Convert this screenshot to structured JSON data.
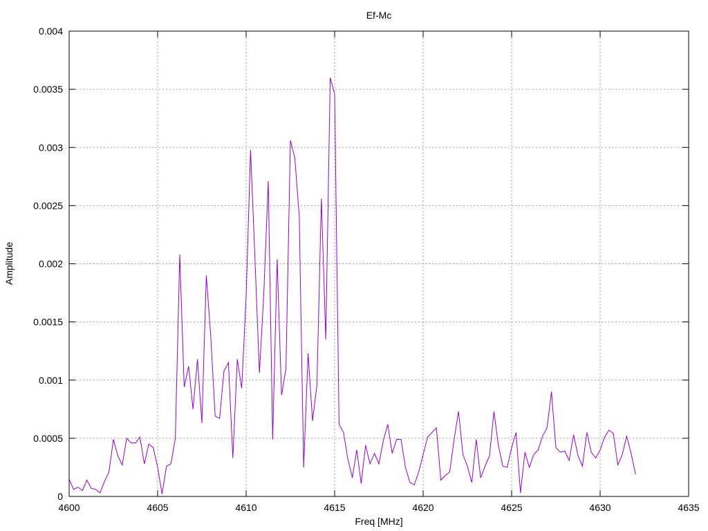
{
  "chart_data": {
    "type": "line",
    "title": "Ef-Mc",
    "xlabel": "Freq [MHz]",
    "ylabel": "Amplitude",
    "xlim": [
      4600,
      4635
    ],
    "ylim": [
      0,
      0.004
    ],
    "xticks": [
      4600,
      4605,
      4610,
      4615,
      4620,
      4625,
      4630,
      4635
    ],
    "yticks": [
      0,
      0.0005,
      0.001,
      0.0015,
      0.002,
      0.0025,
      0.003,
      0.0035,
      0.004
    ],
    "xtick_labels": [
      "4600",
      "4605",
      "4610",
      "4615",
      "4620",
      "4625",
      "4630",
      "4635"
    ],
    "ytick_labels": [
      "0",
      "0.0005",
      "0.001",
      "0.0015",
      "0.002",
      "0.0025",
      "0.003",
      "0.0035",
      "0.004"
    ],
    "grid": true,
    "series": [
      {
        "color": "#9400d3",
        "x": [
          4600.0,
          4600.25,
          4600.5,
          4600.75,
          4601.0,
          4601.25,
          4601.5,
          4601.75,
          4602.0,
          4602.25,
          4602.5,
          4602.75,
          4603.0,
          4603.25,
          4603.5,
          4603.75,
          4604.0,
          4604.25,
          4604.5,
          4604.75,
          4605.0,
          4605.25,
          4605.5,
          4605.75,
          4606.0,
          4606.25,
          4606.5,
          4606.75,
          4607.0,
          4607.25,
          4607.5,
          4607.75,
          4608.0,
          4608.25,
          4608.5,
          4608.75,
          4609.0,
          4609.25,
          4609.5,
          4609.75,
          4610.0,
          4610.25,
          4610.5,
          4610.75,
          4611.0,
          4611.25,
          4611.5,
          4611.75,
          4612.0,
          4612.25,
          4612.5,
          4612.75,
          4613.0,
          4613.25,
          4613.5,
          4613.75,
          4614.0,
          4614.25,
          4614.5,
          4614.75,
          4615.0,
          4615.25,
          4615.5,
          4615.75,
          4616.0,
          4616.25,
          4616.5,
          4616.75,
          4617.0,
          4617.25,
          4617.5,
          4617.75,
          4618.0,
          4618.25,
          4618.5,
          4618.75,
          4619.0,
          4619.25,
          4619.5,
          4619.75,
          4620.0,
          4620.25,
          4620.5,
          4620.75,
          4621.0,
          4621.25,
          4621.5,
          4621.75,
          4622.0,
          4622.25,
          4622.5,
          4622.75,
          4623.0,
          4623.25,
          4623.5,
          4623.75,
          4624.0,
          4624.25,
          4624.5,
          4624.75,
          4625.0,
          4625.25,
          4625.5,
          4625.75,
          4626.0,
          4626.25,
          4626.5,
          4626.75,
          4627.0,
          4627.25,
          4627.5,
          4627.75,
          4628.0,
          4628.25,
          4628.5,
          4628.75,
          4629.0,
          4629.25,
          4629.5,
          4629.75,
          4630.0,
          4630.25,
          4630.5,
          4630.75,
          4631.0,
          4631.25,
          4631.5,
          4631.75,
          4632.0
        ],
        "y": [
          0.00015,
          6e-05,
          8e-05,
          5e-05,
          0.00014,
          7e-05,
          6e-05,
          3e-05,
          0.00013,
          0.00021,
          0.00049,
          0.00035,
          0.00027,
          0.0005,
          0.00046,
          0.00046,
          0.00051,
          0.00028,
          0.00045,
          0.00042,
          0.00025,
          2e-05,
          0.00026,
          0.00028,
          0.0005,
          0.00208,
          0.00094,
          0.00112,
          0.00075,
          0.00118,
          0.00063,
          0.0019,
          0.00138,
          0.00069,
          0.00067,
          0.00108,
          0.00115,
          0.00033,
          0.00118,
          0.00093,
          0.00172,
          0.00298,
          0.00204,
          0.00106,
          0.00175,
          0.00271,
          0.00049,
          0.00204,
          0.00087,
          0.0011,
          0.00306,
          0.00291,
          0.00241,
          0.00025,
          0.00123,
          0.00065,
          0.00096,
          0.00256,
          0.00135,
          0.0036,
          0.00346,
          0.00062,
          0.00055,
          0.00032,
          0.00016,
          0.0004,
          0.00011,
          0.00044,
          0.00028,
          0.00037,
          0.00028,
          0.00048,
          0.00062,
          0.00037,
          0.00049,
          0.00049,
          0.00025,
          0.00012,
          0.0001,
          0.00021,
          0.00036,
          0.00051,
          0.00055,
          0.00059,
          0.00014,
          0.00018,
          0.00021,
          0.00049,
          0.00073,
          0.00036,
          0.00026,
          0.00012,
          0.00049,
          0.00016,
          0.00026,
          0.00035,
          0.00073,
          0.00044,
          0.00026,
          0.00025,
          0.00042,
          0.00055,
          3e-05,
          0.00038,
          0.00025,
          0.00036,
          0.0004,
          0.00052,
          0.00059,
          0.0009,
          0.00042,
          0.00038,
          0.00039,
          0.00031,
          0.00053,
          0.00035,
          0.00026,
          0.00055,
          0.00038,
          0.00033,
          0.0004,
          0.00051,
          0.00057,
          0.00054,
          0.00027,
          0.00036,
          0.00052,
          0.00037,
          0.00019
        ]
      }
    ]
  }
}
